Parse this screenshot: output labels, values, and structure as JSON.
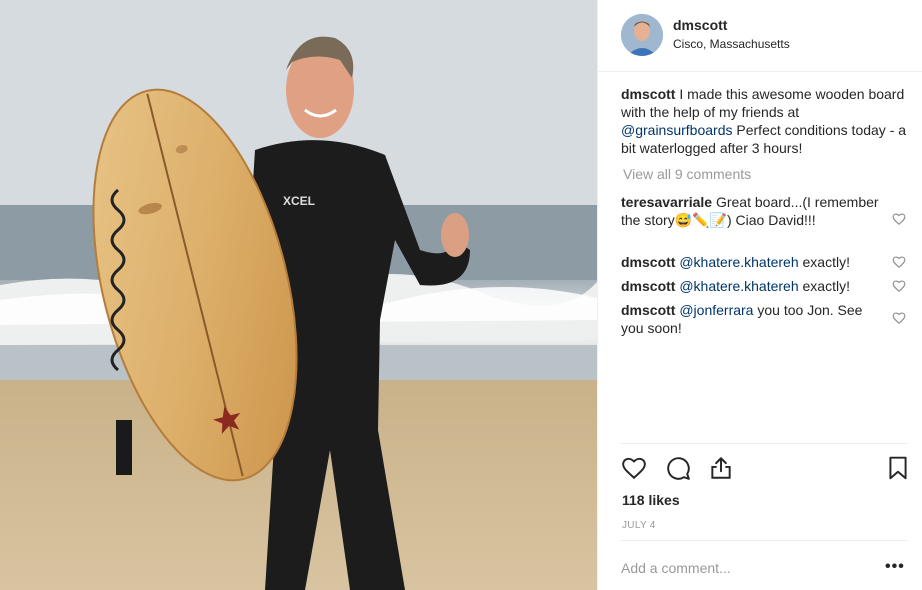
{
  "post": {
    "image_alt": "Man in XCEL wetsuit holding wooden surfboard on beach",
    "wetsuit_brand": "XCEL"
  },
  "header": {
    "username": "dmscott",
    "location": "Cisco, Massachusetts"
  },
  "caption": {
    "username": "dmscott",
    "text_before": " I made this awesome wooden board with the help of my friends at ",
    "mention": "@grainsurfboards",
    "text_after": " Perfect conditions today - a bit waterlogged after 3 hours!"
  },
  "view_all_comments": "View all 9 comments",
  "comments": [
    {
      "username": "teresavarriale",
      "text": " Great board...(I remember the story😅✏️📝) Ciao David!!!",
      "mention": ""
    },
    {
      "username": "dmscott",
      "mention": "@khatere.khatereh",
      "text": " exactly!"
    },
    {
      "username": "dmscott",
      "mention": "@khatere.khatereh",
      "text": " exactly!"
    },
    {
      "username": "dmscott",
      "mention": "@jonferrara",
      "text": " you too Jon. See you soon!"
    }
  ],
  "icons": {
    "like": "heart-icon",
    "comment": "comment-bubble-icon",
    "share": "share-icon",
    "save": "bookmark-icon",
    "comment_like": "heart-icon",
    "more": "more-options-icon"
  },
  "likes": "118 likes",
  "date": "JULY 4",
  "add_comment": {
    "placeholder": "Add a comment...",
    "more_label": "•••"
  },
  "colors": {
    "mention": "#003569",
    "text": "#262626",
    "muted": "#999999",
    "divider": "#efefef"
  }
}
